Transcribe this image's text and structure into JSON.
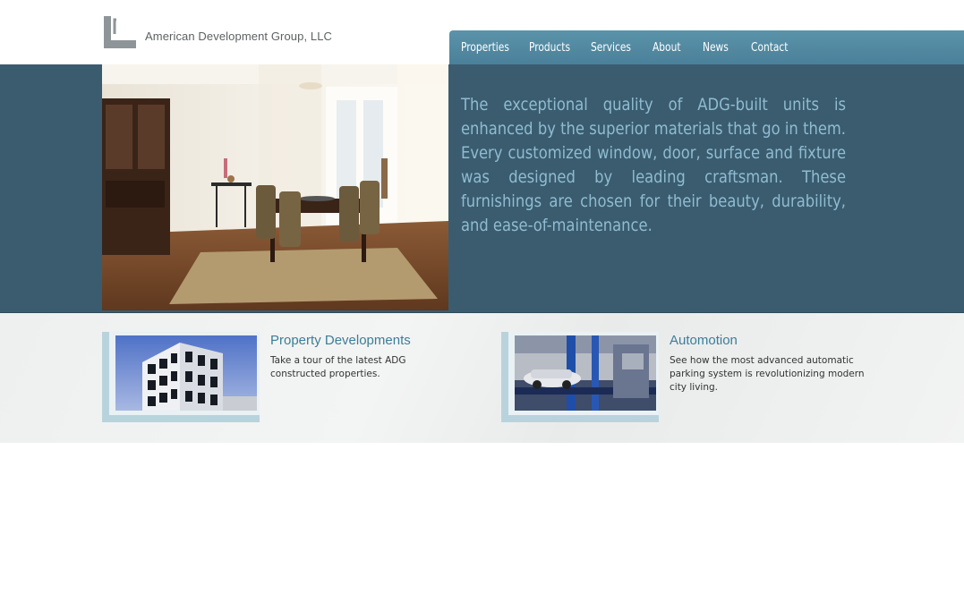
{
  "header": {
    "brand": "American Development Group, LLC"
  },
  "nav": {
    "items": [
      "Properties",
      "Products",
      "Services",
      "About",
      "News",
      "Contact"
    ]
  },
  "hero": {
    "text": "The exceptional quality of ADG-built units is enhanced by the superior materials that go in them. Every customized window, door, surface and fixture was designed by leading craftsman. These furnishings are chosen for their beauty, durability, and ease-of-maintenance."
  },
  "features": [
    {
      "title": "Property Developments",
      "text": "Take a tour of the latest ADG constructed properties."
    },
    {
      "title": "Automotion",
      "text": "See how the most advanced automatic parking system is revolutionizing modern city living."
    }
  ],
  "colors": {
    "nav": "#4a8099",
    "hero_band": "#3b5c6f",
    "hero_text": "#8fbcd1",
    "card_title": "#3c7d99"
  }
}
